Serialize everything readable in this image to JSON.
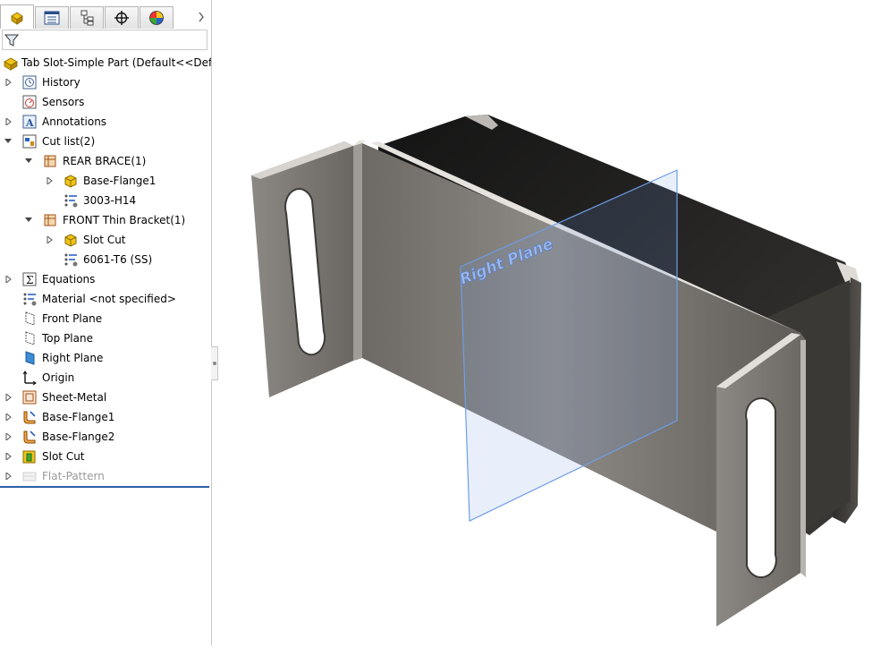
{
  "tabs": [
    {
      "name": "feature-manager-tab",
      "icon": "part-icon",
      "active": true
    },
    {
      "name": "property-manager-tab",
      "icon": "property-list-icon",
      "active": false
    },
    {
      "name": "configuration-manager-tab",
      "icon": "configuration-tree-icon",
      "active": false
    },
    {
      "name": "dimxpert-manager-tab",
      "icon": "crosshair-icon",
      "active": false
    },
    {
      "name": "display-manager-tab",
      "icon": "appearance-sphere-icon",
      "active": false
    }
  ],
  "tree": {
    "root": "Tab Slot-Simple Part  (Default<<Default",
    "items": [
      {
        "label": "History",
        "icon": "history-icon",
        "level": 1,
        "expander": "collapsed"
      },
      {
        "label": "Sensors",
        "icon": "sensor-icon",
        "level": 1,
        "expander": "none"
      },
      {
        "label": "Annotations",
        "icon": "annotation-icon",
        "level": 1,
        "expander": "collapsed"
      },
      {
        "label": "Cut list(2)",
        "icon": "cut-list-icon",
        "level": 1,
        "expander": "expanded"
      },
      {
        "label": "REAR BRACE(1)",
        "icon": "cut-list-item-icon",
        "level": 2,
        "expander": "expanded"
      },
      {
        "label": "Base-Flange1",
        "icon": "solid-body-icon",
        "level": 3,
        "expander": "collapsed"
      },
      {
        "label": "3003-H14",
        "icon": "material-icon",
        "level": 3,
        "expander": "none"
      },
      {
        "label": "FRONT Thin Bracket(1)",
        "icon": "cut-list-item-icon",
        "level": 2,
        "expander": "expanded"
      },
      {
        "label": "Slot Cut",
        "icon": "solid-body-icon",
        "level": 3,
        "expander": "collapsed"
      },
      {
        "label": "6061-T6 (SS)",
        "icon": "material-icon",
        "level": 3,
        "expander": "none"
      },
      {
        "label": "Equations",
        "icon": "equations-icon",
        "level": 1,
        "expander": "collapsed"
      },
      {
        "label": "Material <not specified>",
        "icon": "material-icon",
        "level": 1,
        "expander": "none"
      },
      {
        "label": "Front Plane",
        "icon": "plane-icon",
        "level": 1,
        "expander": "none"
      },
      {
        "label": "Top Plane",
        "icon": "plane-icon",
        "level": 1,
        "expander": "none"
      },
      {
        "label": "Right Plane",
        "icon": "plane-selected-icon",
        "level": 1,
        "expander": "none"
      },
      {
        "label": "Origin",
        "icon": "origin-icon",
        "level": 1,
        "expander": "none"
      },
      {
        "label": "Sheet-Metal",
        "icon": "sheet-metal-icon",
        "level": 1,
        "expander": "collapsed"
      },
      {
        "label": "Base-Flange1",
        "icon": "base-flange-icon",
        "level": 1,
        "expander": "collapsed"
      },
      {
        "label": "Base-Flange2",
        "icon": "base-flange-icon",
        "level": 1,
        "expander": "collapsed"
      },
      {
        "label": "Slot Cut",
        "icon": "cut-extrude-icon",
        "level": 1,
        "expander": "collapsed"
      },
      {
        "label": "Flat-Pattern",
        "icon": "flat-pattern-icon",
        "level": 1,
        "expander": "collapsed",
        "suppressed": true
      }
    ]
  },
  "viewport": {
    "plane_label": "Right Plane"
  },
  "colors": {
    "selection_blue": "#2b5fa8",
    "plane_blue": "#6f9ee8",
    "suppressed_text": "#9a9a9a",
    "part_dark": "#3a3836",
    "part_light": "#b7b4b0"
  }
}
